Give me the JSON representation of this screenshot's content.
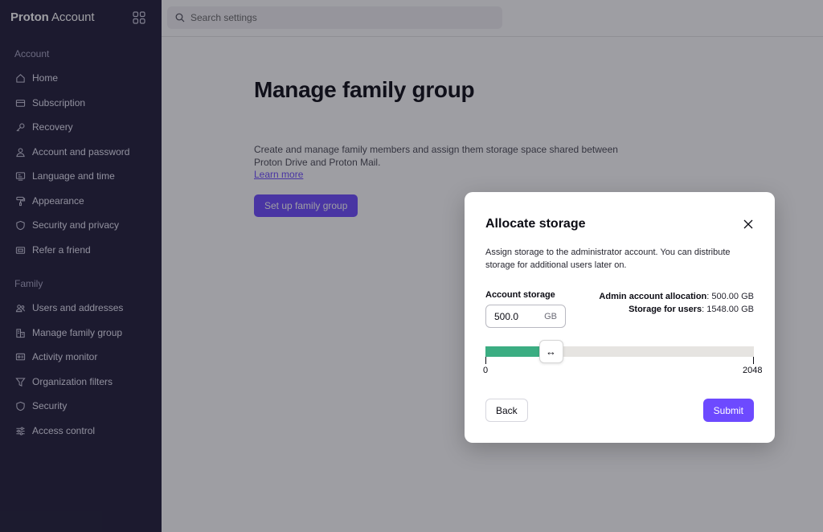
{
  "sidebar": {
    "brand_bold": "Proton",
    "brand_rest": " Account",
    "apps_icon": "apps-grid-icon",
    "section_account": "Account",
    "account_items": [
      {
        "label": "Home",
        "icon": "home-icon"
      },
      {
        "label": "Subscription",
        "icon": "credit-card-icon"
      },
      {
        "label": "Recovery",
        "icon": "key-icon"
      },
      {
        "label": "Account and password",
        "icon": "user-icon"
      },
      {
        "label": "Language and time",
        "icon": "language-icon"
      },
      {
        "label": "Appearance",
        "icon": "paint-roller-icon"
      },
      {
        "label": "Security and privacy",
        "icon": "shield-icon"
      },
      {
        "label": "Refer a friend",
        "icon": "gift-card-icon"
      }
    ],
    "section_family": "Family",
    "family_items": [
      {
        "label": "Users and addresses",
        "icon": "users-icon"
      },
      {
        "label": "Manage family group",
        "icon": "buildings-icon"
      },
      {
        "label": "Activity monitor",
        "icon": "monitor-icon"
      },
      {
        "label": "Organization filters",
        "icon": "filter-icon"
      },
      {
        "label": "Security",
        "icon": "shield-icon"
      },
      {
        "label": "Access control",
        "icon": "sliders-icon"
      }
    ]
  },
  "search": {
    "placeholder": "Search settings"
  },
  "page": {
    "title": "Manage family group",
    "description": "Create and manage family members and assign them storage space shared between Proton Drive and Proton Mail.",
    "learn_more": "Learn more",
    "setup_button": "Set up family group"
  },
  "modal": {
    "title": "Allocate storage",
    "description": "Assign storage to the administrator account. You can distribute storage for additional users later on.",
    "account_storage_label": "Account storage",
    "amount_value": "500.0",
    "unit": "GB",
    "admin_allocation_label": "Admin account allocation",
    "admin_allocation_value": ": 500.00 GB",
    "users_storage_label": "Storage for users",
    "users_storage_value": ": 1548.00 GB",
    "slider": {
      "min_label": "0",
      "max_label": "2048",
      "min": 0,
      "max": 2048,
      "value": 500
    },
    "handle_glyph": "↔",
    "back_button": "Back",
    "submit_button": "Submit",
    "fill_color": "#3bad82",
    "accent_color": "#6d4aff"
  }
}
